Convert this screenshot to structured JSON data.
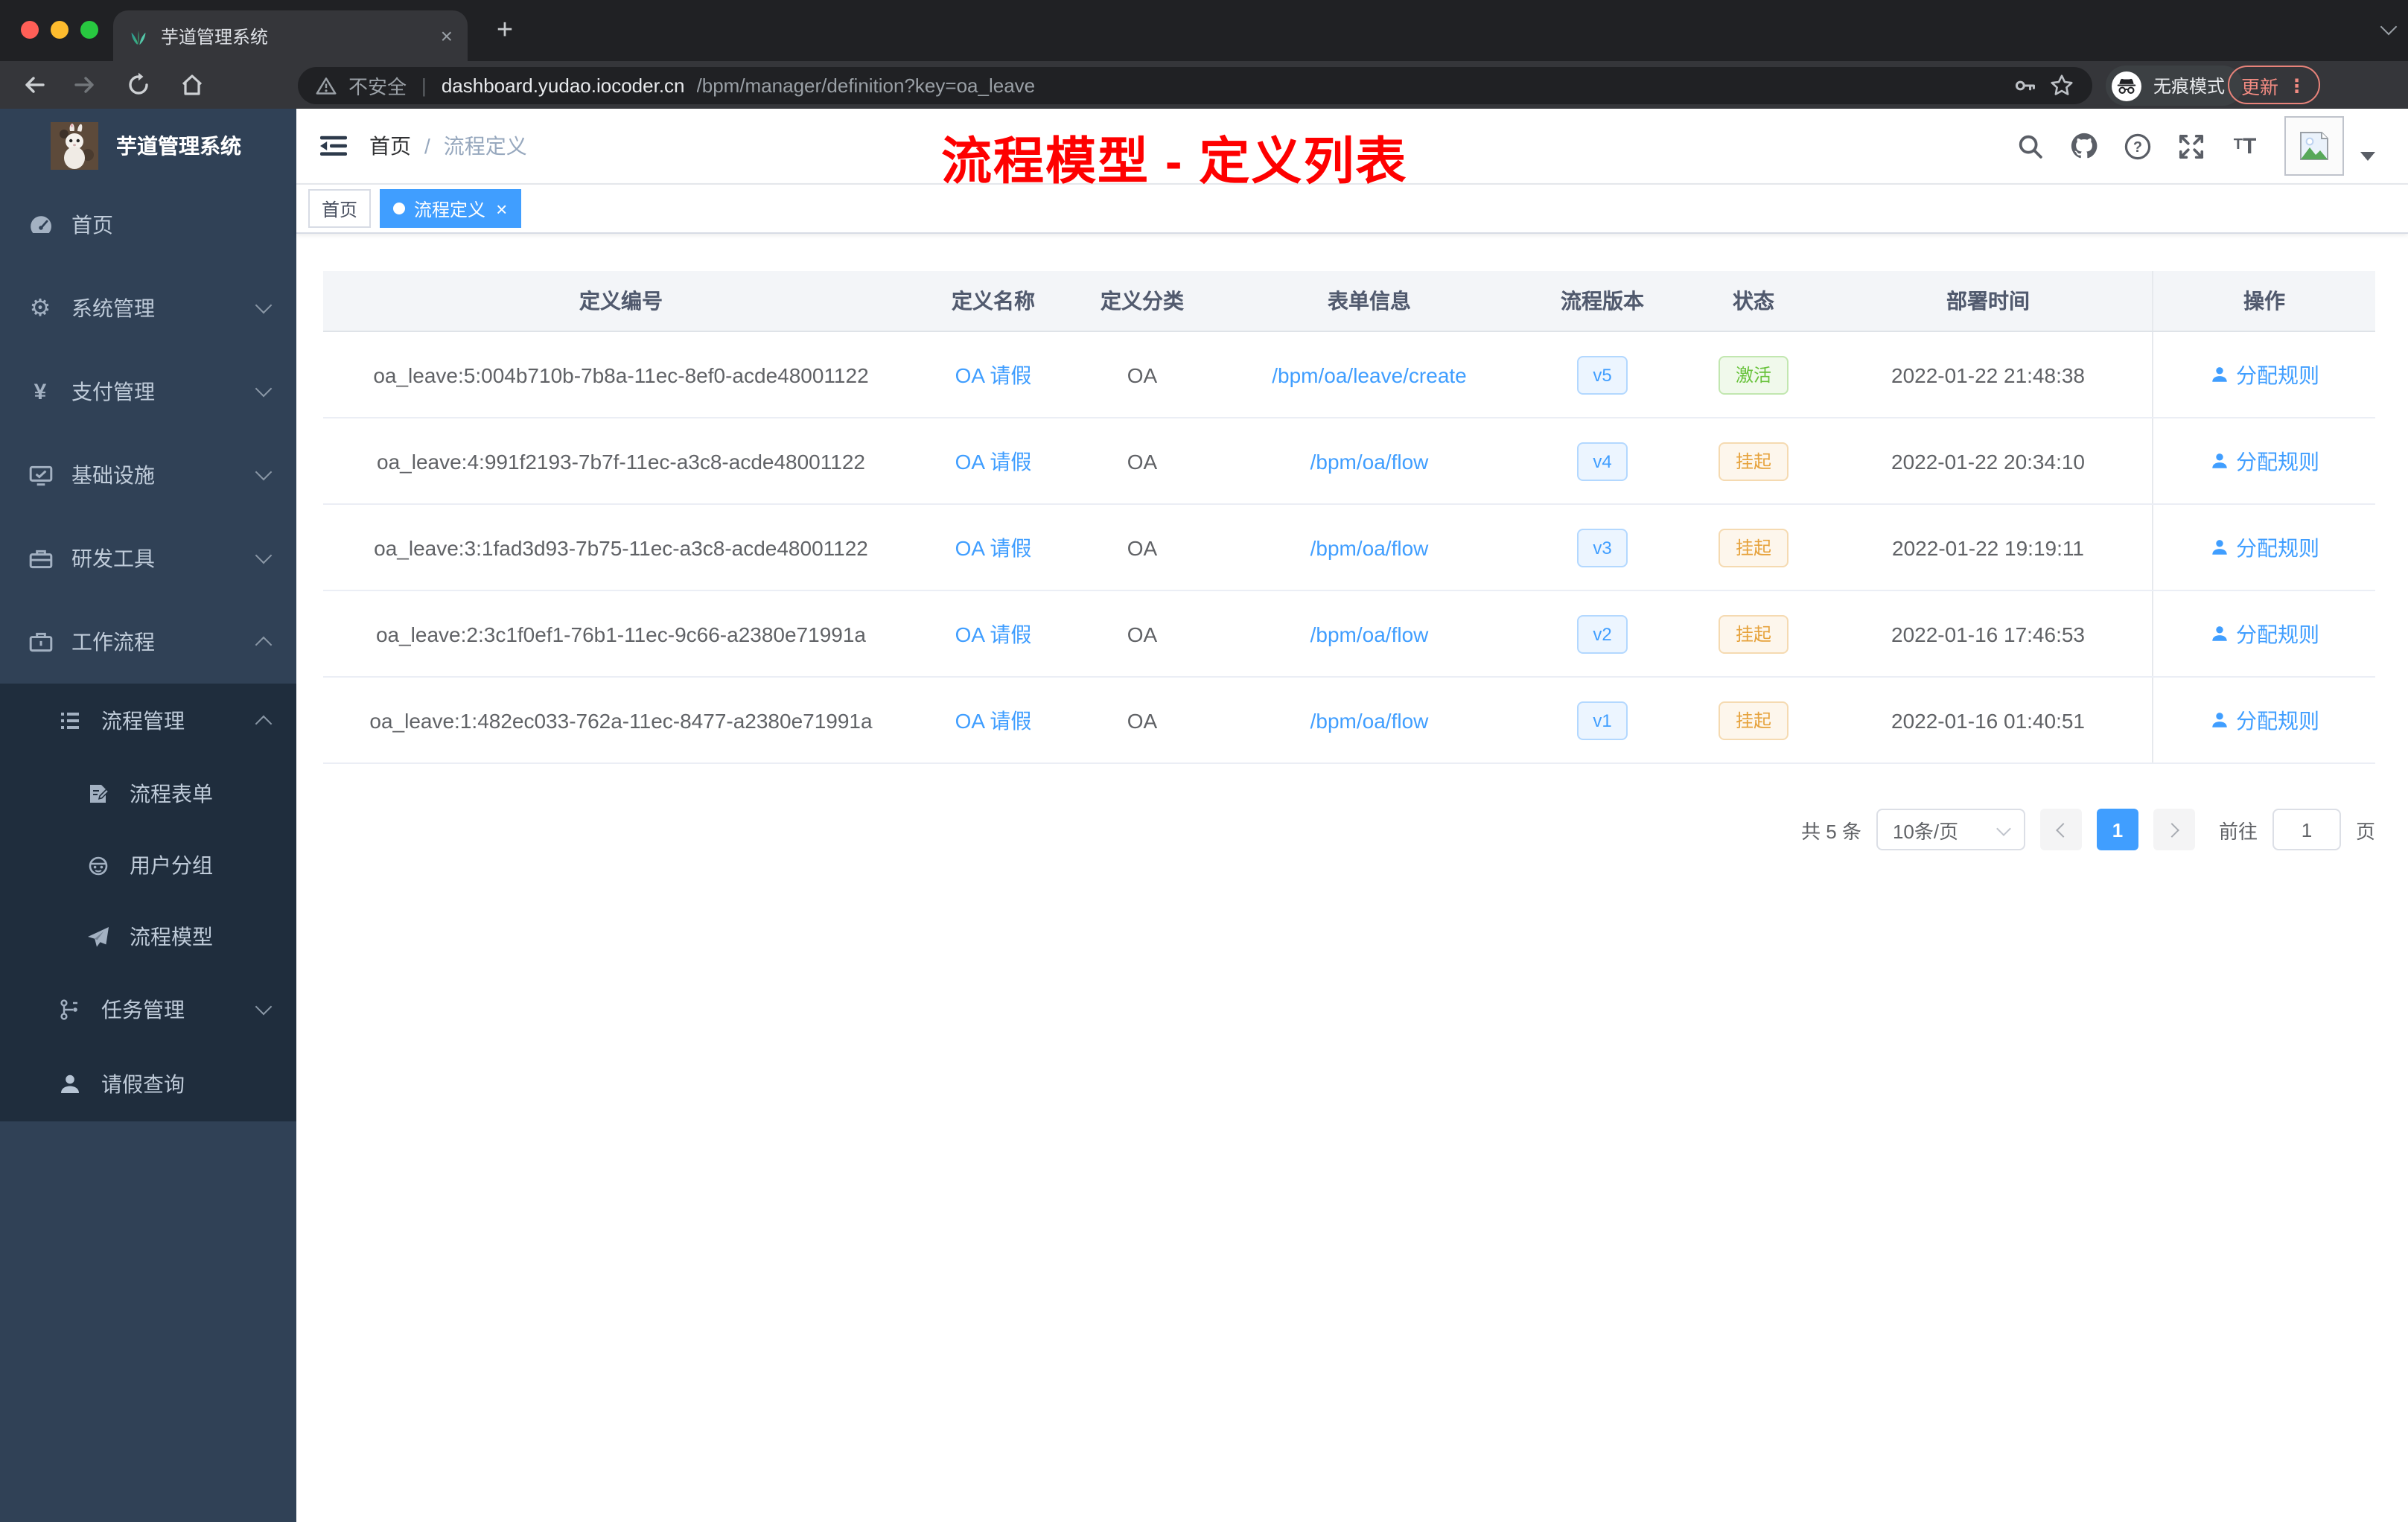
{
  "browser": {
    "tab_title": "芋道管理系统",
    "tab_close_glyph": "×",
    "new_tab_glyph": "+",
    "security_label": "不安全",
    "url_host": "dashboard.yudao.iocoder.cn",
    "url_path": "/bpm/manager/definition?key=oa_leave",
    "incognito_label": "无痕模式",
    "update_label": "更新",
    "menu_dots_glyph": "⋮"
  },
  "sidebar": {
    "logo_title": "芋道管理系统",
    "menu": [
      {
        "label": "首页",
        "icon": "dashboard-icon"
      },
      {
        "label": "系统管理",
        "icon": "gear-icon"
      },
      {
        "label": "支付管理",
        "icon": "yen-icon",
        "icon_glyph": "¥"
      },
      {
        "label": "基础设施",
        "icon": "monitor-icon"
      },
      {
        "label": "研发工具",
        "icon": "toolbox-icon"
      },
      {
        "label": "工作流程",
        "icon": "briefcase-icon"
      }
    ],
    "workflow_submenu": [
      {
        "label": "流程管理",
        "icon": "list-icon"
      },
      {
        "label": "流程表单",
        "icon": "form-icon"
      },
      {
        "label": "用户分组",
        "icon": "robot-icon"
      },
      {
        "label": "流程模型",
        "icon": "paper-plane-icon"
      },
      {
        "label": "任务管理",
        "icon": "tree-icon"
      },
      {
        "label": "请假查询",
        "icon": "user-icon"
      }
    ]
  },
  "header": {
    "breadcrumb_home": "首页",
    "breadcrumb_sep": "/",
    "breadcrumb_current": "流程定义",
    "annotation": "流程模型 - 定义列表",
    "annotation_color": "#fe0000"
  },
  "tags": [
    {
      "label": "首页",
      "active": false
    },
    {
      "label": "流程定义",
      "active": true,
      "close_glyph": "×"
    }
  ],
  "table": {
    "columns": [
      "定义编号",
      "定义名称",
      "定义分类",
      "表单信息",
      "流程版本",
      "状态",
      "部署时间",
      "操作"
    ],
    "rows": [
      {
        "id": "oa_leave:5:004b710b-7b8a-11ec-8ef0-acde48001122",
        "name": "OA 请假",
        "category": "OA",
        "form": "/bpm/oa/leave/create",
        "version": "v5",
        "status": "激活",
        "deployed": "2022-01-22 21:48:38",
        "action": "分配规则"
      },
      {
        "id": "oa_leave:4:991f2193-7b7f-11ec-a3c8-acde48001122",
        "name": "OA 请假",
        "category": "OA",
        "form": "/bpm/oa/flow",
        "version": "v4",
        "status": "挂起",
        "deployed": "2022-01-22 20:34:10",
        "action": "分配规则"
      },
      {
        "id": "oa_leave:3:1fad3d93-7b75-11ec-a3c8-acde48001122",
        "name": "OA 请假",
        "category": "OA",
        "form": "/bpm/oa/flow",
        "version": "v3",
        "status": "挂起",
        "deployed": "2022-01-22 19:19:11",
        "action": "分配规则"
      },
      {
        "id": "oa_leave:2:3c1f0ef1-76b1-11ec-9c66-a2380e71991a",
        "name": "OA 请假",
        "category": "OA",
        "form": "/bpm/oa/flow",
        "version": "v2",
        "status": "挂起",
        "deployed": "2022-01-16 17:46:53",
        "action": "分配规则"
      },
      {
        "id": "oa_leave:1:482ec033-762a-11ec-8477-a2380e71991a",
        "name": "OA 请假",
        "category": "OA",
        "form": "/bpm/oa/flow",
        "version": "v1",
        "status": "挂起",
        "deployed": "2022-01-16 01:40:51",
        "action": "分配规则"
      }
    ]
  },
  "pagination": {
    "total": "共 5 条",
    "page_size": "10条/页",
    "current_page": "1",
    "goto_label": "前往",
    "goto_value": "1",
    "unit_label": "页"
  },
  "colors": {
    "primary": "#409eff",
    "success": "#67c23a",
    "warning": "#e6a23c",
    "annotation_red": "#fe0000",
    "sidebar_bg": "#304156",
    "sidebar_submenu_bg": "#1f2d3d",
    "browser_frame": "#202124",
    "browser_toolbar": "#35363a"
  }
}
